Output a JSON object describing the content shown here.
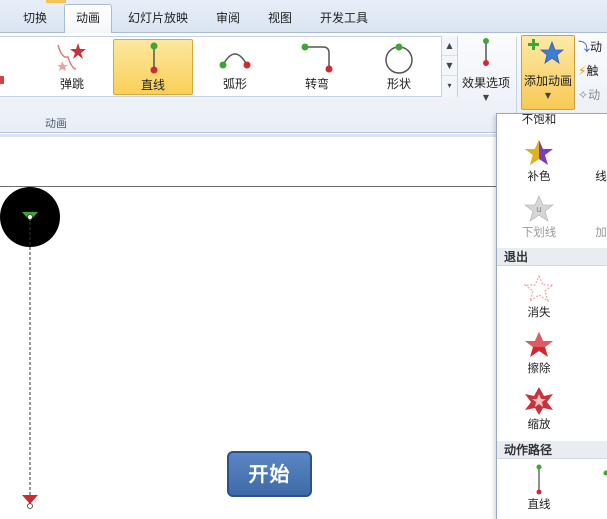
{
  "tabs": [
    {
      "label": "切换",
      "active": false
    },
    {
      "label": "动画",
      "active": true
    },
    {
      "label": "幻灯片放映",
      "active": false
    },
    {
      "label": "审阅",
      "active": false
    },
    {
      "label": "视图",
      "active": false
    },
    {
      "label": "开发工具",
      "active": false
    }
  ],
  "ribbon": {
    "gallery_items": [
      {
        "label": "弹跳",
        "icon": "bounce-star-icon",
        "selected": false
      },
      {
        "label": "直线",
        "icon": "line-path-icon",
        "selected": true
      },
      {
        "label": "弧形",
        "icon": "arc-path-icon",
        "selected": false
      },
      {
        "label": "转弯",
        "icon": "turn-path-icon",
        "selected": false
      },
      {
        "label": "形状",
        "icon": "shape-path-icon",
        "selected": false
      }
    ],
    "group_label": "动画",
    "effect_options_label": "效果选项",
    "add_animation_label": "添加动画",
    "mini_items": [
      "动",
      "触",
      "动"
    ]
  },
  "slide": {
    "start_button_label": "开始"
  },
  "panel": {
    "top_partial_label": "不饱和",
    "row1": [
      {
        "label": "补色",
        "disabled": false
      },
      {
        "label": "线",
        "disabled": false
      }
    ],
    "row2": [
      {
        "label": "下划线",
        "disabled": true
      },
      {
        "label": "加",
        "disabled": true
      }
    ],
    "exit_header": "退出",
    "exit_items": [
      {
        "label": "消失"
      },
      {
        "label": "擦除"
      },
      {
        "label": "缩放"
      }
    ],
    "path_header": "动作路径",
    "path_items": [
      {
        "label": "直线"
      }
    ]
  },
  "colors": {
    "accent_selected": "#f9cf57",
    "start_button": "#4a78b8",
    "path_green": "#3fa535",
    "path_red": "#d2282f"
  }
}
